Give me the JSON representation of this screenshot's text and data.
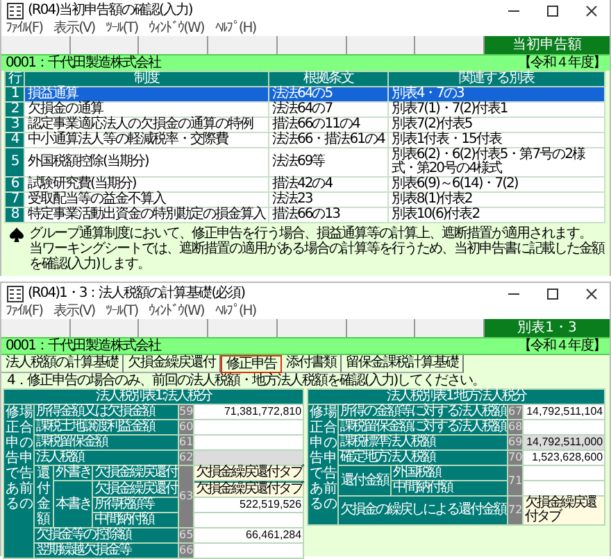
{
  "windows": [
    {
      "title": "(R04)当初申告額の確認(入力)",
      "menu": [
        "ﾌｧｲﾙ(F)",
        "表示(V)",
        "ﾂｰﾙ(T)",
        "ｳｨﾝﾄﾞｳ(W)",
        "ﾍﾙﾌﾟ(H)"
      ],
      "toolbar_label": "当初申告額",
      "company": "0001：千代田製造株式会社",
      "year": "【令和４年度】"
    },
    {
      "title": "(R04)1・3：法人税額の計算基礎(必須)",
      "menu": [
        "ﾌｧｲﾙ(F)",
        "表示(V)",
        "ﾂｰﾙ(T)",
        "ｳｨﾝﾄﾞｳ(W)",
        "ﾍﾙﾌﾟ(H)"
      ],
      "toolbar_label": "別表1・3",
      "company": "0001：千代田製造株式会社",
      "year": "【令和４年度】"
    }
  ],
  "systems_table": {
    "columns": [
      "行",
      "制度",
      "根拠条文",
      "関連する別表"
    ],
    "rows": [
      {
        "no": "1",
        "system": "損益通算",
        "basis": "法法64の5",
        "schedules": "別表4・7の3",
        "selected": true
      },
      {
        "no": "2",
        "system": "欠損金の通算",
        "basis": "法法64の7",
        "schedules": "別表7(1)・7(2)付表1",
        "selected": false
      },
      {
        "no": "3",
        "system": "認定事業適応法人の欠損金の通算の特例",
        "basis": "措法66の11の4",
        "schedules": "別表7(2)付表5",
        "selected": false
      },
      {
        "no": "4",
        "system": "中小通算法人等の軽減税率・交際費",
        "basis": "法法66・措法61の4",
        "schedules": "別表1付表・15付表",
        "selected": false
      },
      {
        "no": "5",
        "system": "外国税額控除(当期分)",
        "basis": "法法69等",
        "schedules": "別表6(2)・6(2)付表5・第7号の2様式・第20号の4様式",
        "selected": false
      },
      {
        "no": "6",
        "system": "試験研究費(当期分)",
        "basis": "措法42の4",
        "schedules": "別表6(9)～6(14)・7(2)",
        "selected": false
      },
      {
        "no": "7",
        "system": "受取配当等の益金不算入",
        "basis": "法法23",
        "schedules": "別表8(1)付表2",
        "selected": false
      },
      {
        "no": "8",
        "system": "特定事業活動出資金の特別勘定の損金算入",
        "basis": "措法66の13",
        "schedules": "別表10(6)付表2",
        "selected": false
      }
    ]
  },
  "note": [
    "グループ通算制度において、修正申告を行う場合、損益通算等の計算上、遮断措置が適用されます。",
    "当ワーキングシートでは、遮断措置の適用がある場合の計算等を行うため、当初申告書に記載した金額を確認(入力)します。"
  ],
  "tabs": [
    {
      "label": "法人税額の計算基礎",
      "selected": false
    },
    {
      "label": "欠損金繰戻還付",
      "selected": false
    },
    {
      "label": "修正申告",
      "selected": true
    },
    {
      "label": "添付書類",
      "selected": false
    },
    {
      "label": "留保金課税計算基礎",
      "selected": false
    }
  ],
  "instruction": "4．修正申告の場合のみ、前回の法人税額・地方法人税額を確認(入力)してください。",
  "tax_tables": [
    {
      "title": "法人税別表1:法人税分",
      "side_label": [
        "修正申告である",
        "場合の申告前の"
      ],
      "rows": [
        {
          "kind": "line",
          "label": "所得金額又は欠損金額",
          "no": "59",
          "field": {
            "kind": "input",
            "disabled": false,
            "value": "71,381,772,810"
          }
        },
        {
          "kind": "line",
          "label": "課税土地譲渡利益金額",
          "no": "60",
          "field": {
            "kind": "input",
            "disabled": false
          }
        },
        {
          "kind": "line",
          "label": "課税留保金額",
          "no": "61",
          "field": {
            "kind": "input",
            "disabled": false
          }
        },
        {
          "kind": "line",
          "label": "法人税額",
          "no": "62",
          "field": {
            "kind": "input",
            "disabled": true
          }
        },
        {
          "kind": "nested_group",
          "label": "還付金額",
          "no": "63",
          "subgroups": [
            {
              "label": "外書き",
              "items": [
                {
                  "label": "欠損金繰戻還付",
                  "field": {
                    "kind": "link",
                    "value": "欠損金繰戻還付タブ"
                  }
                }
              ]
            },
            {
              "label": "本書き",
              "items": [
                {
                  "label": "欠損金繰戻還付",
                  "field": {
                    "kind": "link",
                    "value": "欠損金繰戻還付タブ"
                  }
                },
                {
                  "label": "所得税額等",
                  "field": {
                    "kind": "input",
                    "disabled": false,
                    "value": "522,519,526"
                  }
                },
                {
                  "label": "中間納付額",
                  "field": {
                    "kind": "input",
                    "disabled": false
                  }
                }
              ]
            }
          ]
        },
        {
          "kind": "line",
          "label": "欠損金等の控除額",
          "no": "65",
          "field": {
            "kind": "input",
            "disabled": false,
            "value": "66,461,284"
          }
        },
        {
          "kind": "line",
          "label": "翌期繰越欠損金等",
          "no": "66",
          "field": {
            "kind": "input",
            "disabled": false
          }
        }
      ]
    },
    {
      "title": "法人税別表1:地方法人税分",
      "side_label": [
        "修正申告である",
        "場合の申告前の"
      ],
      "rows": [
        {
          "kind": "line",
          "label": "所得の金額等に対する法人税額",
          "no": "67",
          "field": {
            "kind": "input",
            "disabled": false,
            "value": "14,792,511,104"
          }
        },
        {
          "kind": "line",
          "label": "課税留保金額に対する法人税額",
          "no": "68",
          "field": {
            "kind": "input",
            "disabled": false
          }
        },
        {
          "kind": "line",
          "label": "課税標準法人税額",
          "no": "69",
          "field": {
            "kind": "input",
            "disabled": true,
            "value": "14,792,511,000"
          }
        },
        {
          "kind": "line",
          "label": "確定地方法人税額",
          "no": "70",
          "field": {
            "kind": "input",
            "disabled": false,
            "value": "1,523,628,600"
          }
        },
        {
          "kind": "group",
          "label": "還付金額",
          "no": "71",
          "items": [
            {
              "label": "外国税額",
              "field": {
                "kind": "input",
                "disabled": false
              }
            },
            {
              "label": "中間納付額",
              "field": {
                "kind": "input",
                "disabled": false
              }
            }
          ]
        },
        {
          "kind": "line",
          "label": "欠損金の繰戻しによる還付金額",
          "no": "72",
          "field": {
            "kind": "link",
            "value": "欠損金繰戻還付タブ"
          }
        }
      ]
    }
  ]
}
